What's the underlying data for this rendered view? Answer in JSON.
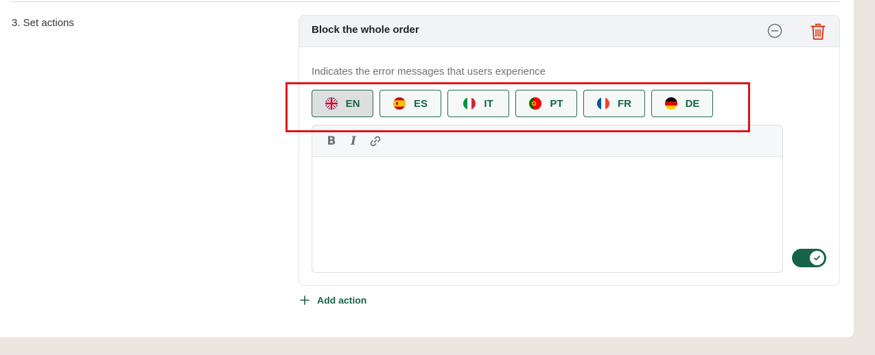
{
  "section": {
    "label": "3. Set actions"
  },
  "action": {
    "title": "Block the whole order",
    "helper_text": "Indicates the error messages that users experience",
    "languages": [
      {
        "code": "EN",
        "flag": "uk-flag-icon",
        "active": true
      },
      {
        "code": "ES",
        "flag": "spain-flag-icon",
        "active": false
      },
      {
        "code": "IT",
        "flag": "italy-flag-icon",
        "active": false
      },
      {
        "code": "PT",
        "flag": "portugal-flag-icon",
        "active": false
      },
      {
        "code": "FR",
        "flag": "france-flag-icon",
        "active": false
      },
      {
        "code": "DE",
        "flag": "germany-flag-icon",
        "active": false
      }
    ],
    "editor": {
      "toolbar": [
        "bold-icon",
        "italic-icon",
        "link-icon"
      ],
      "value": ""
    },
    "toggle": {
      "enabled": true
    }
  },
  "add_action": {
    "label": "Add action",
    "icon": "plus-icon"
  },
  "colors": {
    "accent": "#17634a",
    "highlight": "#e0141d",
    "delete": "#d72c0d"
  }
}
